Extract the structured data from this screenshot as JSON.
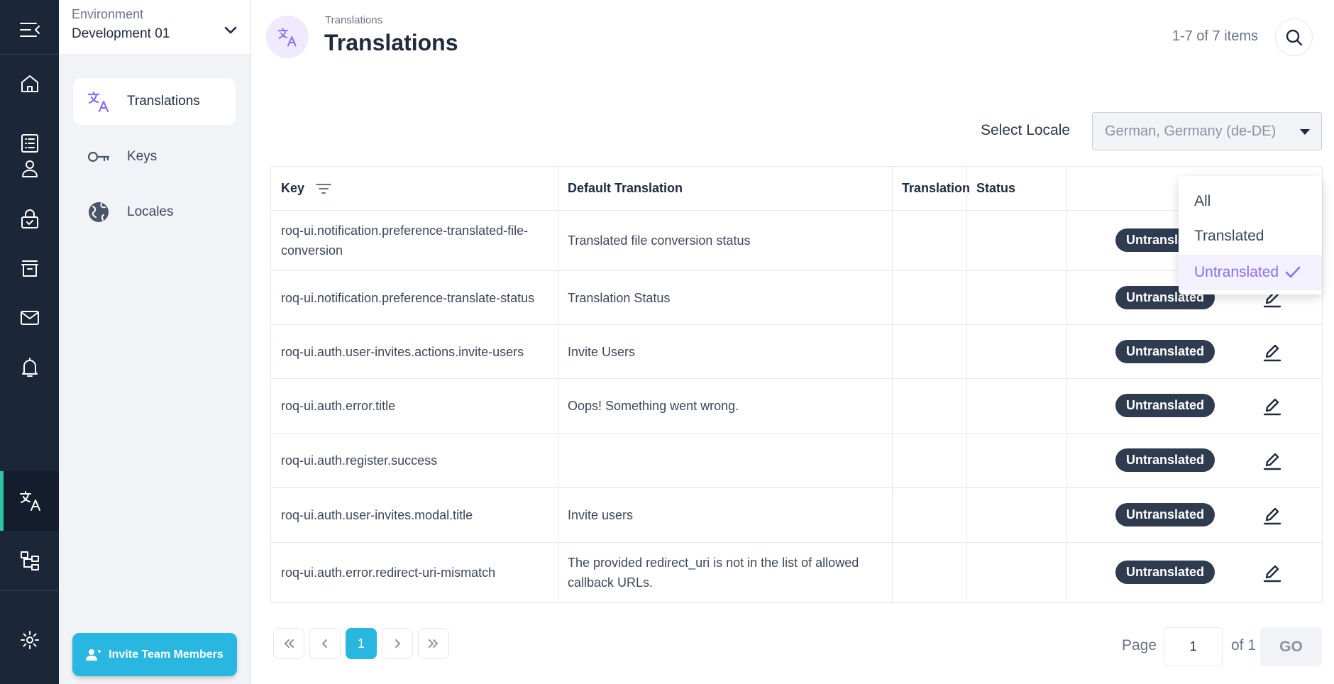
{
  "environment": {
    "label": "Environment",
    "value": "Development 01"
  },
  "nav": [
    {
      "label": "Translations",
      "icon": "translate-icon",
      "active": true
    },
    {
      "label": "Keys",
      "icon": "key-icon",
      "active": false
    },
    {
      "label": "Locales",
      "icon": "globe-icon",
      "active": false
    }
  ],
  "rail_icons": [
    "collapse-menu-icon",
    "home-icon",
    "list-icon",
    "user-icon",
    "lock-icon",
    "archive-icon",
    "mail-icon",
    "bell-icon",
    "translate-icon",
    "hierarchy-icon",
    "gear-icon"
  ],
  "invite_button": "Invite Team Members",
  "header": {
    "breadcrumb": "Translations",
    "title": "Translations",
    "items_count": "1-7 of 7 items"
  },
  "locale": {
    "label": "Select Locale",
    "value": "German, Germany (de-DE)"
  },
  "table": {
    "columns": [
      "Key",
      "Default Translation",
      "Translation",
      "Status"
    ],
    "rows": [
      {
        "key": "roq-ui.notification.preference-translated-file-conversion",
        "default": "Translated file conversion status",
        "translation": "",
        "status": "Untranslated"
      },
      {
        "key": "roq-ui.notification.preference-translate-status",
        "default": "Translation Status",
        "translation": "",
        "status": "Untranslated"
      },
      {
        "key": "roq-ui.auth.user-invites.actions.invite-users",
        "default": "Invite Users",
        "translation": "",
        "status": "Untranslated"
      },
      {
        "key": "roq-ui.auth.error.title",
        "default": "Oops! Something went wrong.",
        "translation": "",
        "status": "Untranslated"
      },
      {
        "key": "roq-ui.auth.register.success",
        "default": "",
        "translation": "",
        "status": "Untranslated"
      },
      {
        "key": "roq-ui.auth.user-invites.modal.title",
        "default": "Invite users",
        "translation": "",
        "status": "Untranslated"
      },
      {
        "key": "roq-ui.auth.error.redirect-uri-mismatch",
        "default": "The provided redirect_uri is not in the list of allowed callback URLs.",
        "translation": "",
        "status": "Untranslated"
      }
    ]
  },
  "status_filter": {
    "options": [
      "All",
      "Translated",
      "Untranslated"
    ],
    "selected": "Untranslated"
  },
  "pagination": {
    "current_page": "1",
    "page_label": "Page",
    "page_input": "1",
    "of_label": "of 1",
    "go_label": "GO"
  },
  "colors": {
    "rail": "#1c2639",
    "accent_teal": "#2ec4a6",
    "primary_blue": "#29b6e0",
    "purple": "#8b6df0",
    "badge": "#2f3b4f"
  }
}
